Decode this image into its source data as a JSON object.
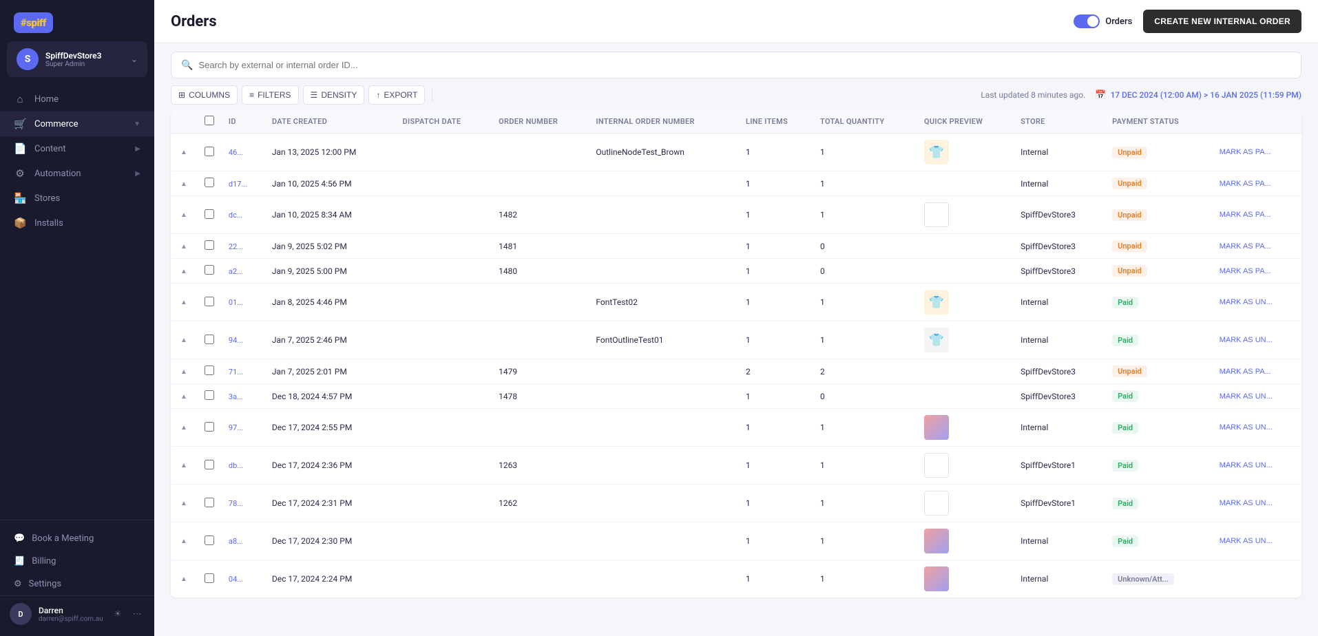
{
  "sidebar": {
    "logo": "#spiff",
    "logo_highlight": "spiff",
    "user": {
      "name": "SpiffDevStore3",
      "role": "Super Admin",
      "initial": "S"
    },
    "nav_items": [
      {
        "id": "home",
        "label": "Home",
        "icon": "🏠",
        "active": false
      },
      {
        "id": "commerce",
        "label": "Commerce",
        "icon": "🛒",
        "active": false,
        "has_arrow": true
      },
      {
        "id": "content",
        "label": "Content",
        "icon": "📄",
        "active": false,
        "has_arrow": true
      },
      {
        "id": "automation",
        "label": "Automation",
        "icon": "⚙️",
        "active": false,
        "has_arrow": true
      },
      {
        "id": "stores",
        "label": "Stores",
        "icon": "🏪",
        "active": false
      },
      {
        "id": "installs",
        "label": "Installs",
        "icon": "📦",
        "active": false
      }
    ],
    "book_meeting": "Book a Meeting",
    "billing": "Billing",
    "settings": "Settings",
    "bottom_user": {
      "name": "Darren",
      "email": "darren@spiff.com.au",
      "initials": "D"
    }
  },
  "topbar": {
    "title": "Orders",
    "orders_toggle_label": "Orders",
    "create_btn": "CREATE NEW INTERNAL ORDER"
  },
  "search": {
    "placeholder": "Search by external or internal order ID..."
  },
  "toolbar": {
    "columns_btn": "COLUMNS",
    "filters_btn": "FILTERS",
    "density_btn": "DENSITY",
    "export_btn": "EXPORT",
    "status_text": "Last updated 8 minutes ago.",
    "date_range": "17 DEC 2024 (12:00 AM) > 16 JAN 2025 (11:59 PM)"
  },
  "table": {
    "columns": [
      "",
      "",
      "ID",
      "Date Created",
      "Dispatch Date",
      "Order Number",
      "Internal Order Number",
      "Line Items",
      "Total Quantity",
      "Quick Preview",
      "Store",
      "Payment Status",
      ""
    ],
    "rows": [
      {
        "id": "46...",
        "date_created": "Jan 13, 2025 12:00 PM",
        "dispatch_date": "",
        "order_number": "",
        "internal_order_number": "OutlineNodeTest_Brown",
        "line_items": "1",
        "total_quantity": "1",
        "preview_type": "tshirt_orange",
        "store": "Internal",
        "payment_status": "Unpaid",
        "mark_label": "MARK AS PA..."
      },
      {
        "id": "d17...",
        "date_created": "Jan 10, 2025 4:56 PM",
        "dispatch_date": "",
        "order_number": "",
        "internal_order_number": "",
        "line_items": "1",
        "total_quantity": "1",
        "preview_type": "none",
        "store": "Internal",
        "payment_status": "Unpaid",
        "mark_label": "MARK AS PA..."
      },
      {
        "id": "dc...",
        "date_created": "Jan 10, 2025 8:34 AM",
        "dispatch_date": "",
        "order_number": "1482",
        "internal_order_number": "",
        "line_items": "1",
        "total_quantity": "1",
        "preview_type": "white",
        "store": "SpiffDevStore3",
        "payment_status": "Unpaid",
        "mark_label": "MARK AS PA..."
      },
      {
        "id": "22...",
        "date_created": "Jan 9, 2025 5:02 PM",
        "dispatch_date": "",
        "order_number": "1481",
        "internal_order_number": "",
        "line_items": "1",
        "total_quantity": "0",
        "preview_type": "none",
        "store": "SpiffDevStore3",
        "payment_status": "Unpaid",
        "mark_label": "MARK AS PA..."
      },
      {
        "id": "a2...",
        "date_created": "Jan 9, 2025 5:00 PM",
        "dispatch_date": "",
        "order_number": "1480",
        "internal_order_number": "",
        "line_items": "1",
        "total_quantity": "0",
        "preview_type": "none",
        "store": "SpiffDevStore3",
        "payment_status": "Unpaid",
        "mark_label": "MARK AS PA..."
      },
      {
        "id": "01...",
        "date_created": "Jan 8, 2025 4:46 PM",
        "dispatch_date": "",
        "order_number": "",
        "internal_order_number": "FontTest02",
        "line_items": "1",
        "total_quantity": "1",
        "preview_type": "tshirt_orange",
        "store": "Internal",
        "payment_status": "Paid",
        "mark_label": "MARK AS UN..."
      },
      {
        "id": "94...",
        "date_created": "Jan 7, 2025 2:46 PM",
        "dispatch_date": "",
        "order_number": "",
        "internal_order_number": "FontOutlineTest01",
        "line_items": "1",
        "total_quantity": "1",
        "preview_type": "tshirt_black",
        "store": "Internal",
        "payment_status": "Paid",
        "mark_label": "MARK AS UN..."
      },
      {
        "id": "71...",
        "date_created": "Jan 7, 2025 2:01 PM",
        "dispatch_date": "",
        "order_number": "1479",
        "internal_order_number": "",
        "line_items": "2",
        "total_quantity": "2",
        "preview_type": "none",
        "store": "SpiffDevStore3",
        "payment_status": "Unpaid",
        "mark_label": "MARK AS PA..."
      },
      {
        "id": "3a...",
        "date_created": "Dec 18, 2024 4:57 PM",
        "dispatch_date": "",
        "order_number": "1478",
        "internal_order_number": "",
        "line_items": "1",
        "total_quantity": "0",
        "preview_type": "none",
        "store": "SpiffDevStore3",
        "payment_status": "Paid",
        "mark_label": "MARK AS UN..."
      },
      {
        "id": "97...",
        "date_created": "Dec 17, 2024 2:55 PM",
        "dispatch_date": "",
        "order_number": "",
        "internal_order_number": "",
        "line_items": "1",
        "total_quantity": "1",
        "preview_type": "circle",
        "store": "Internal",
        "payment_status": "Paid",
        "mark_label": "MARK AS UN..."
      },
      {
        "id": "db...",
        "date_created": "Dec 17, 2024 2:36 PM",
        "dispatch_date": "",
        "order_number": "1263",
        "internal_order_number": "",
        "line_items": "1",
        "total_quantity": "1",
        "preview_type": "white",
        "store": "SpiffDevStore1",
        "payment_status": "Paid",
        "mark_label": "MARK AS UN..."
      },
      {
        "id": "78...",
        "date_created": "Dec 17, 2024 2:31 PM",
        "dispatch_date": "",
        "order_number": "1262",
        "internal_order_number": "",
        "line_items": "1",
        "total_quantity": "1",
        "preview_type": "white",
        "store": "SpiffDevStore1",
        "payment_status": "Paid",
        "mark_label": "MARK AS UN..."
      },
      {
        "id": "a8...",
        "date_created": "Dec 17, 2024 2:30 PM",
        "dispatch_date": "",
        "order_number": "",
        "internal_order_number": "",
        "line_items": "1",
        "total_quantity": "1",
        "preview_type": "circle",
        "store": "Internal",
        "payment_status": "Paid",
        "mark_label": "MARK AS UN..."
      },
      {
        "id": "04...",
        "date_created": "Dec 17, 2024 2:24 PM",
        "dispatch_date": "",
        "order_number": "",
        "internal_order_number": "",
        "line_items": "1",
        "total_quantity": "1",
        "preview_type": "circle2",
        "store": "Internal",
        "payment_status": "Unknown/Att...",
        "mark_label": ""
      }
    ]
  }
}
